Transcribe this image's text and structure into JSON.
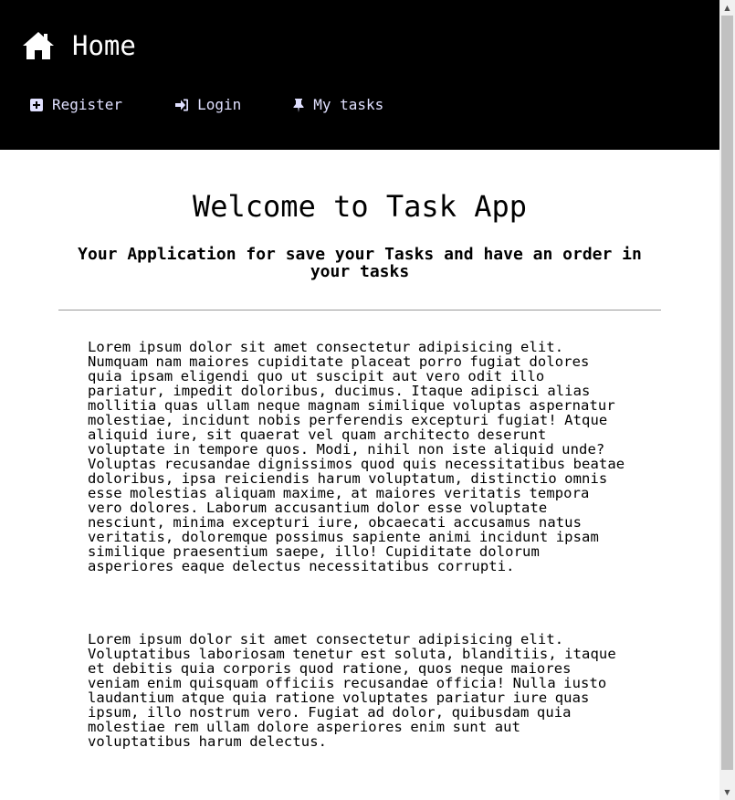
{
  "header": {
    "brand": {
      "title": "Home",
      "icon": "home-icon"
    },
    "nav": [
      {
        "label": "Register",
        "icon": "plus-square-icon"
      },
      {
        "label": "Login",
        "icon": "sign-in-icon"
      },
      {
        "label": "My tasks",
        "icon": "thumbtack-icon"
      }
    ],
    "background": "#000000",
    "nav_color": "#e0e0ff"
  },
  "main": {
    "title": "Welcome to Task App",
    "subtitle": "Your Application for save your Tasks and have an order in your tasks",
    "paragraphs": [
      "Lorem ipsum dolor sit amet consectetur adipisicing elit. Numquam nam maiores cupiditate placeat porro fugiat dolores quia ipsam eligendi quo ut suscipit aut vero odit illo pariatur, impedit doloribus, ducimus. Itaque adipisci alias mollitia quas ullam neque magnam similique voluptas aspernatur molestiae, incidunt nobis perferendis excepturi fugiat! Atque aliquid iure, sit quaerat vel quam architecto deserunt voluptate in tempore quos. Modi, nihil non iste aliquid unde? Voluptas recusandae dignissimos quod quis necessitatibus beatae doloribus, ipsa reiciendis harum voluptatum, distinctio omnis esse molestias aliquam maxime, at maiores veritatis tempora vero dolores. Laborum accusantium dolor esse voluptate nesciunt, minima excepturi iure, obcaecati accusamus natus veritatis, doloremque possimus sapiente animi incidunt ipsam similique praesentium saepe, illo! Cupiditate dolorum asperiores eaque delectus necessitatibus corrupti.",
      "Lorem ipsum dolor sit amet consectetur adipisicing elit. Voluptatibus laboriosam tenetur est soluta, blanditiis, itaque et debitis quia corporis quod ratione, quos neque maiores veniam enim quisquam officiis recusandae officia! Nulla iusto laudantium atque quia ratione voluptates pariatur iure quas ipsum, illo nostrum vero. Fugiat ad dolor, quibusdam quia molestiae rem ullam dolore asperiores enim sunt aut voluptatibus harum delectus."
    ]
  },
  "scrollbar": {
    "up_icon": "scroll-up-arrow-icon",
    "down_icon": "scroll-down-arrow-icon"
  }
}
